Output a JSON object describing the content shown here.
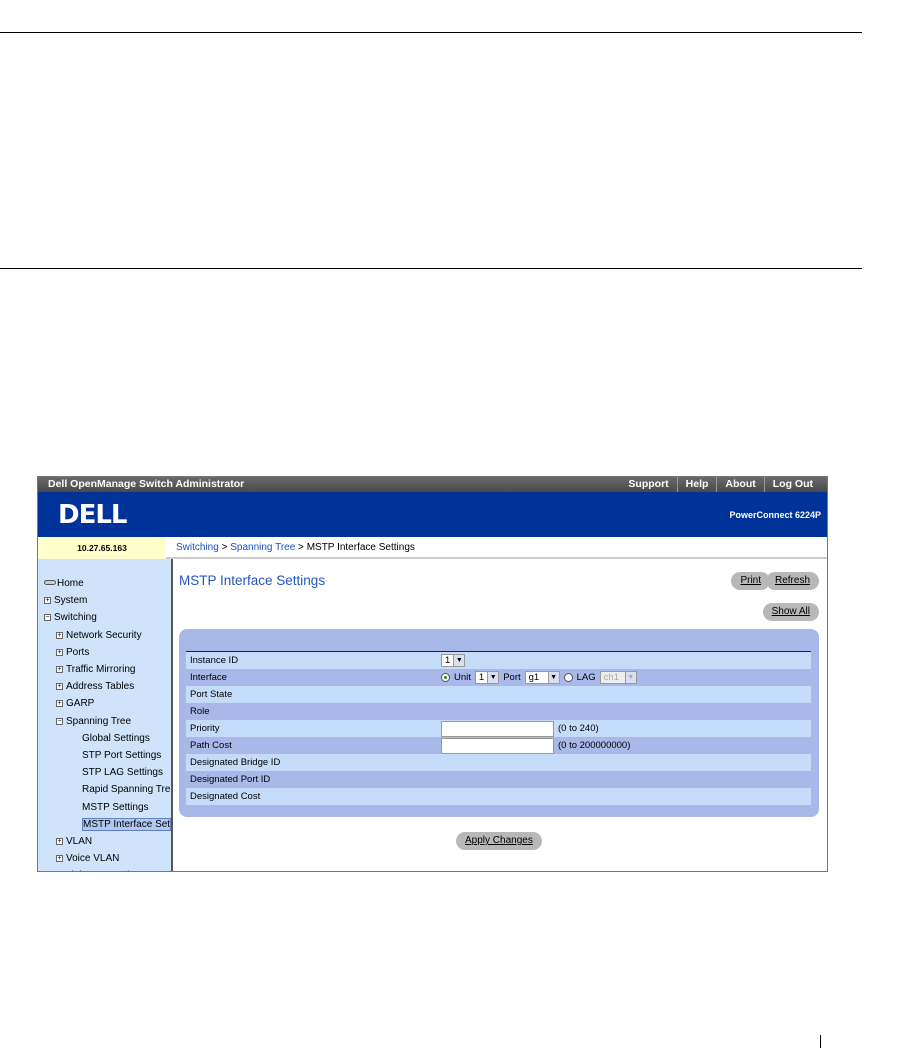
{
  "app": {
    "title": "Dell OpenManage Switch Administrator",
    "links": [
      "Support",
      "Help",
      "About",
      "Log Out"
    ],
    "logo": "DELL",
    "model": "PowerConnect 6224P",
    "address": "10.27.65.163"
  },
  "breadcrumb": {
    "items": [
      "Switching",
      "Spanning Tree"
    ],
    "current": "MSTP Interface Settings",
    "sep": " > "
  },
  "sidebar": {
    "items": [
      {
        "label": "Home",
        "level": 0,
        "icon": "home"
      },
      {
        "label": "System",
        "level": 0,
        "icon": "plus"
      },
      {
        "label": "Switching",
        "level": 0,
        "icon": "minus"
      },
      {
        "label": "Network Security",
        "level": 1,
        "icon": "plus"
      },
      {
        "label": "Ports",
        "level": 1,
        "icon": "plus"
      },
      {
        "label": "Traffic Mirroring",
        "level": 1,
        "icon": "plus"
      },
      {
        "label": "Address Tables",
        "level": 1,
        "icon": "plus"
      },
      {
        "label": "GARP",
        "level": 1,
        "icon": "plus"
      },
      {
        "label": "Spanning Tree",
        "level": 1,
        "icon": "minus"
      },
      {
        "label": "Global Settings",
        "level": 2
      },
      {
        "label": "STP Port Settings",
        "level": 2
      },
      {
        "label": "STP LAG Settings",
        "level": 2
      },
      {
        "label": "Rapid Spanning Tre",
        "level": 2
      },
      {
        "label": "MSTP Settings",
        "level": 2
      },
      {
        "label": "MSTP Interface Set",
        "level": 2,
        "selected": true
      },
      {
        "label": "VLAN",
        "level": 1,
        "icon": "plus"
      },
      {
        "label": "Voice VLAN",
        "level": 1,
        "icon": "plus"
      },
      {
        "label": "Link Aggregation",
        "level": 1,
        "icon": "plus"
      }
    ]
  },
  "page": {
    "title": "MSTP Interface Settings",
    "print": "Print",
    "refresh": "Refresh",
    "show_all": "Show All",
    "apply": "Apply Changes"
  },
  "form": {
    "labels": [
      "Instance ID",
      "Interface",
      "Port State",
      "Role",
      "Priority",
      "Path Cost",
      "Designated Bridge ID",
      "Designated Port ID",
      "Designated Cost"
    ],
    "instance_id": "1",
    "unit_label": "Unit",
    "unit": "1",
    "port_label": "Port",
    "port": "g1",
    "lag_label": "LAG",
    "lag": "ch1",
    "priority_value": "",
    "priority_range": "(0 to 240)",
    "path_cost_value": "",
    "path_cost_range": "(0 to 200000000)"
  }
}
